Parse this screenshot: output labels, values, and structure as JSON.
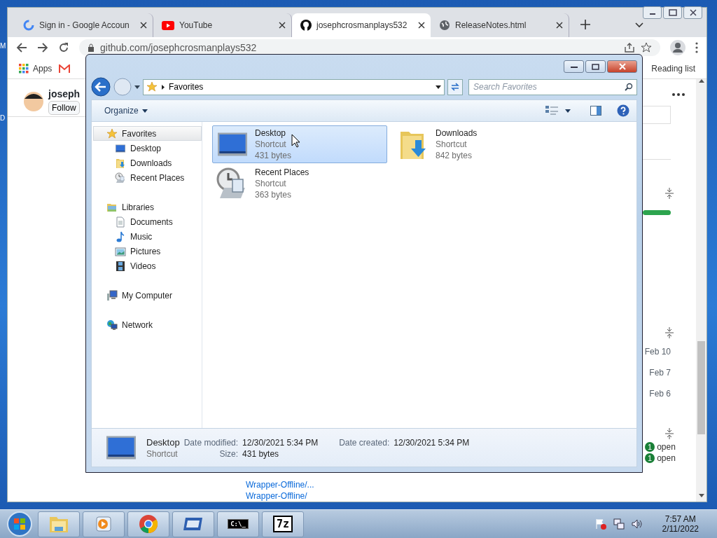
{
  "desktop": {
    "icon_labels": [
      "M",
      "D"
    ]
  },
  "browser": {
    "tabs": [
      {
        "title": "Sign in - Google Accoun",
        "kind": "google",
        "selected": false
      },
      {
        "title": "YouTube",
        "kind": "youtube",
        "selected": false
      },
      {
        "title": "josephcrosmanplays532",
        "kind": "github",
        "selected": true
      },
      {
        "title": "ReleaseNotes.html",
        "kind": "globe",
        "selected": false
      }
    ],
    "address": "github.com/josephcrosmanplays532",
    "apps_label": "Apps",
    "reading_list": "Reading list",
    "page": {
      "user": "joseph",
      "follow_button": "Follow",
      "dates": [
        "Feb 10",
        "Feb 7",
        "Feb 6"
      ],
      "links": [
        "Wrapper-Offline/...",
        "Wrapper-Offline/"
      ],
      "issue_badges": [
        {
          "count": "1",
          "label": "open"
        },
        {
          "count": "1",
          "label": "open"
        }
      ]
    }
  },
  "explorer": {
    "address": "Favorites",
    "search": {
      "placeholder": "Search Favorites"
    },
    "organize": "Organize",
    "nav": [
      {
        "label": "Favorites",
        "kind": "star",
        "selected": true,
        "children": [
          {
            "label": "Desktop",
            "kind": "desktop",
            "selected": false
          },
          {
            "label": "Downloads",
            "kind": "downloads",
            "selected": false
          },
          {
            "label": "Recent Places",
            "kind": "recent",
            "selected": false
          }
        ]
      },
      {
        "label": "Libraries",
        "kind": "libraries",
        "selected": false,
        "children": [
          {
            "label": "Documents",
            "kind": "documents",
            "selected": false
          },
          {
            "label": "Music",
            "kind": "music",
            "selected": false
          },
          {
            "label": "Pictures",
            "kind": "pictures",
            "selected": false
          },
          {
            "label": "Videos",
            "kind": "videos",
            "selected": false
          }
        ]
      },
      {
        "label": "My Computer",
        "kind": "computer",
        "selected": false
      },
      {
        "label": "Network",
        "kind": "network",
        "selected": false
      }
    ],
    "items": [
      {
        "name": "Desktop",
        "type": "Shortcut",
        "size": "431 bytes",
        "kind": "desktop",
        "selected": true
      },
      {
        "name": "Downloads",
        "type": "Shortcut",
        "size": "842 bytes",
        "kind": "downloads",
        "selected": false
      },
      {
        "name": "Recent Places",
        "type": "Shortcut",
        "size": "363 bytes",
        "kind": "recent",
        "selected": false
      }
    ],
    "details": {
      "name": "Desktop",
      "type": "Shortcut",
      "fields": [
        {
          "label": "Date modified:",
          "value": "12/30/2021 5:34 PM"
        },
        {
          "label": "Date created:",
          "value": "12/30/2021 5:34 PM"
        },
        {
          "label": "Size:",
          "value": "431 bytes"
        }
      ]
    }
  },
  "taskbar": {
    "apps": [
      {
        "kind": "explorer"
      },
      {
        "kind": "media"
      },
      {
        "kind": "chrome"
      },
      {
        "kind": "window"
      },
      {
        "kind": "cmd",
        "glyph": "C:\\_"
      },
      {
        "kind": "sevenzip",
        "glyph": "7z"
      }
    ],
    "clock": {
      "time": "7:57 AM",
      "date": "2/11/2022"
    }
  }
}
